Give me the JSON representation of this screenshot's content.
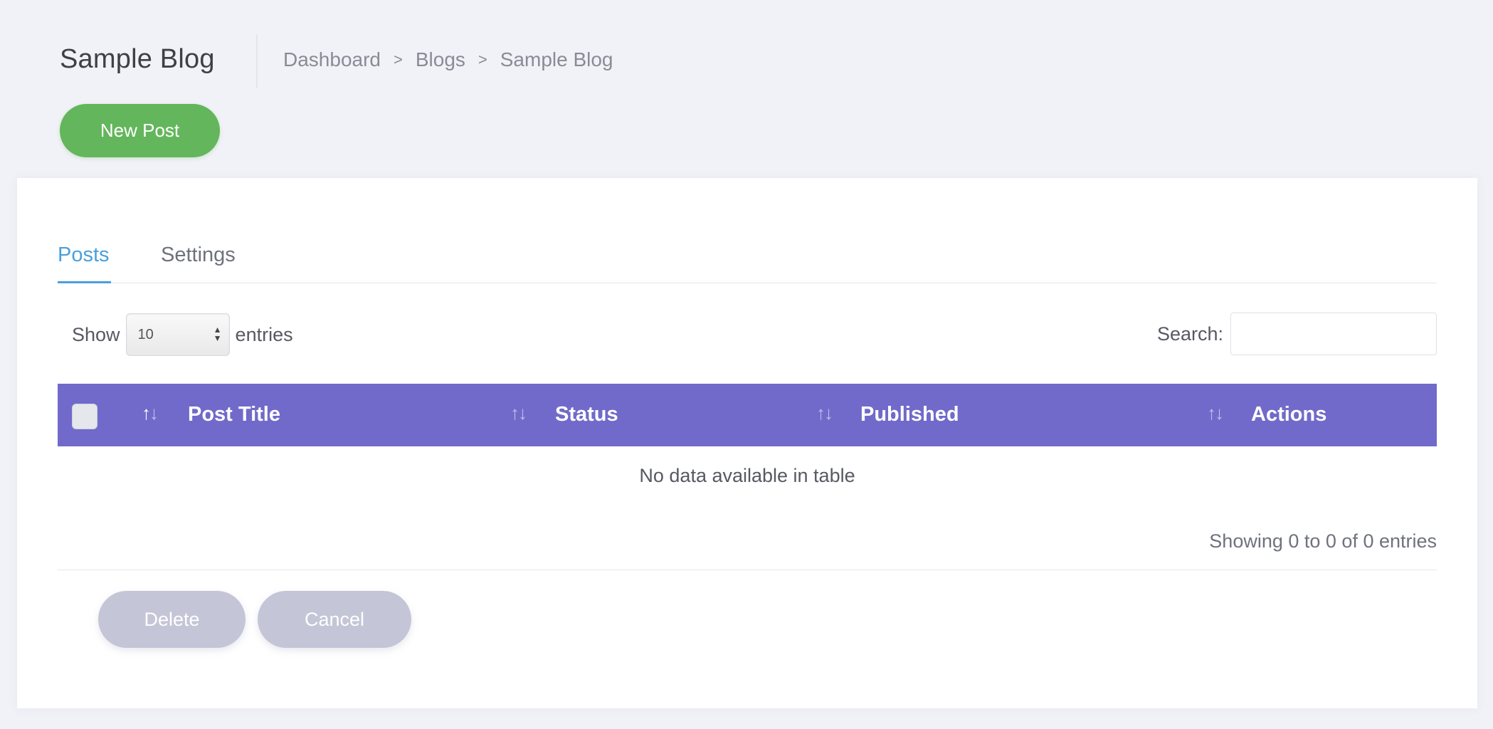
{
  "header": {
    "title": "Sample Blog",
    "breadcrumb": [
      "Dashboard",
      "Blogs",
      "Sample Blog"
    ],
    "breadcrumb_separator": ">",
    "new_post_label": "New Post"
  },
  "tabs": [
    {
      "label": "Posts",
      "active": true
    },
    {
      "label": "Settings",
      "active": false
    }
  ],
  "table_controls": {
    "show_label": "Show",
    "page_length_value": "10",
    "entries_label": "entries",
    "search_label": "Search:",
    "search_value": ""
  },
  "table": {
    "columns": [
      "Post Title",
      "Status",
      "Published",
      "Actions"
    ],
    "empty_message": "No data available in table",
    "info": "Showing 0 to 0 of 0 entries"
  },
  "footer_actions": {
    "delete_label": "Delete",
    "cancel_label": "Cancel"
  },
  "colors": {
    "accent_tab": "#4a9fdc",
    "header_bg": "#716aca",
    "new_post_bg": "#63b65b",
    "disabled_button_bg": "#c4c5d6",
    "page_bg": "#f1f2f7"
  }
}
